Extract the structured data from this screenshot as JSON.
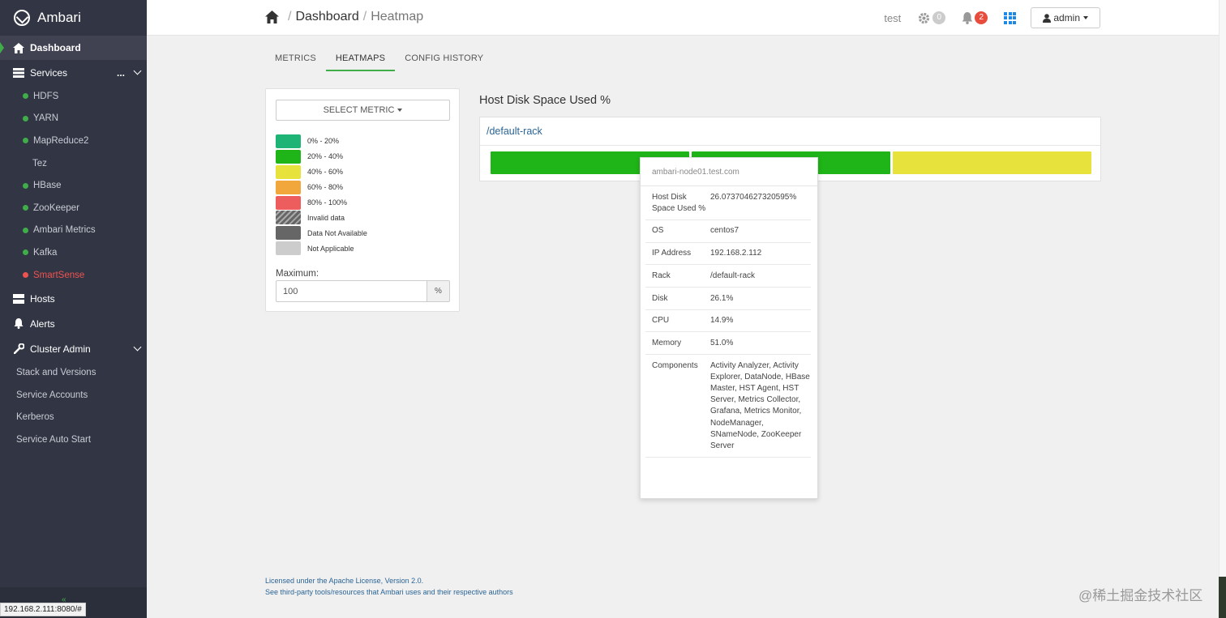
{
  "app": {
    "title": "Ambari"
  },
  "sidebar": {
    "dashboard": "Dashboard",
    "services_label": "Services",
    "services_more": "...",
    "services": [
      {
        "label": "HDFS",
        "status": "ok"
      },
      {
        "label": "YARN",
        "status": "ok"
      },
      {
        "label": "MapReduce2",
        "status": "ok"
      },
      {
        "label": "Tez",
        "status": "none"
      },
      {
        "label": "HBase",
        "status": "ok"
      },
      {
        "label": "ZooKeeper",
        "status": "ok"
      },
      {
        "label": "Ambari Metrics",
        "status": "ok"
      },
      {
        "label": "Kafka",
        "status": "ok"
      },
      {
        "label": "SmartSense",
        "status": "alert"
      }
    ],
    "hosts": "Hosts",
    "alerts": "Alerts",
    "cluster_admin": "Cluster Admin",
    "admin_items": [
      "Stack and Versions",
      "Service Accounts",
      "Kerberos",
      "Service Auto Start"
    ],
    "collapse_icon": "«"
  },
  "status_bar": {
    "url": "192.168.2.111:8080/#"
  },
  "topbar": {
    "breadcrumb": [
      "Dashboard",
      "Heatmap"
    ],
    "breadcrumb_sep": "/",
    "cluster_name": "test",
    "ops_count": "0",
    "alerts_count": "2",
    "user": "admin"
  },
  "tabs": [
    "METRICS",
    "HEATMAPS",
    "CONFIG HISTORY"
  ],
  "legend_panel": {
    "select_metric": "SELECT METRIC",
    "items": [
      {
        "label": "0% - 20%",
        "color": "#1eb475"
      },
      {
        "label": "20% - 40%",
        "color": "#1fb418"
      },
      {
        "label": "40% - 60%",
        "color": "#e8e23c"
      },
      {
        "label": "60% - 80%",
        "color": "#f2a73d"
      },
      {
        "label": "80% - 100%",
        "color": "#ee5d5d"
      },
      {
        "label": "Invalid data",
        "color": "#666666"
      },
      {
        "label": "Data Not Available",
        "color": "#666666"
      },
      {
        "label": "Not Applicable",
        "color": "#cccccc"
      }
    ],
    "maximum_label": "Maximum:",
    "maximum_value": "100",
    "maximum_unit": "%"
  },
  "heatmap": {
    "title": "Host Disk Space Used %",
    "rack": "/default-rack",
    "host_colors": [
      "#1fb418",
      "#1fb418",
      "#e8e23c"
    ]
  },
  "tooltip": {
    "host": "ambari-node01.test.com",
    "rows": [
      {
        "k": "Host Disk Space Used %",
        "v": "26.073704627320595%"
      },
      {
        "k": "OS",
        "v": "centos7"
      },
      {
        "k": "IP Address",
        "v": "192.168.2.112"
      },
      {
        "k": "Rack",
        "v": "/default-rack"
      },
      {
        "k": "Disk",
        "v": "26.1%"
      },
      {
        "k": "CPU",
        "v": "14.9%"
      },
      {
        "k": "Memory",
        "v": "51.0%"
      },
      {
        "k": "Components",
        "v": "Activity Analyzer, Activity Explorer, DataNode, HBase Master, HST Agent, HST Server, Metrics Collector, Grafana, Metrics Monitor, NodeManager, SNameNode, ZooKeeper Server"
      }
    ]
  },
  "footer": {
    "license": "Licensed under the Apache License, Version 2.0.",
    "third_party": "See third-party tools/resources that Ambari uses and their respective authors"
  },
  "watermark": "@稀土掘金技术社区"
}
